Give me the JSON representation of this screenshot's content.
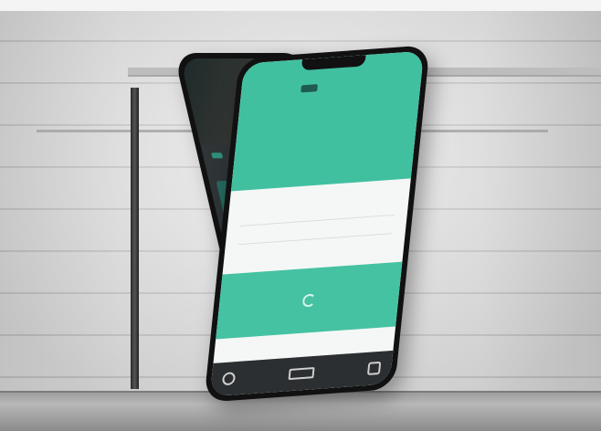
{
  "scene": {
    "description_tags": [
      "phone-mockup",
      "brick-wall",
      "floor"
    ]
  },
  "back_phone": {
    "headline": "",
    "tag": "",
    "logo_text": "",
    "card1_title": "",
    "card1_sub": "",
    "card2_title": ""
  },
  "front_phone": {
    "logo_text": "",
    "headline": "",
    "subtitle": "",
    "row1": "",
    "row2": ""
  },
  "colors": {
    "accent_green": "#45c2a2",
    "dark_teal": "#1f5b4f",
    "wall": "#e4e4e4"
  },
  "icons": {
    "refresh": "refresh-icon",
    "bar_left": "home-icon",
    "bar_mid": "ticket-icon",
    "bar_right": "menu-icon"
  }
}
